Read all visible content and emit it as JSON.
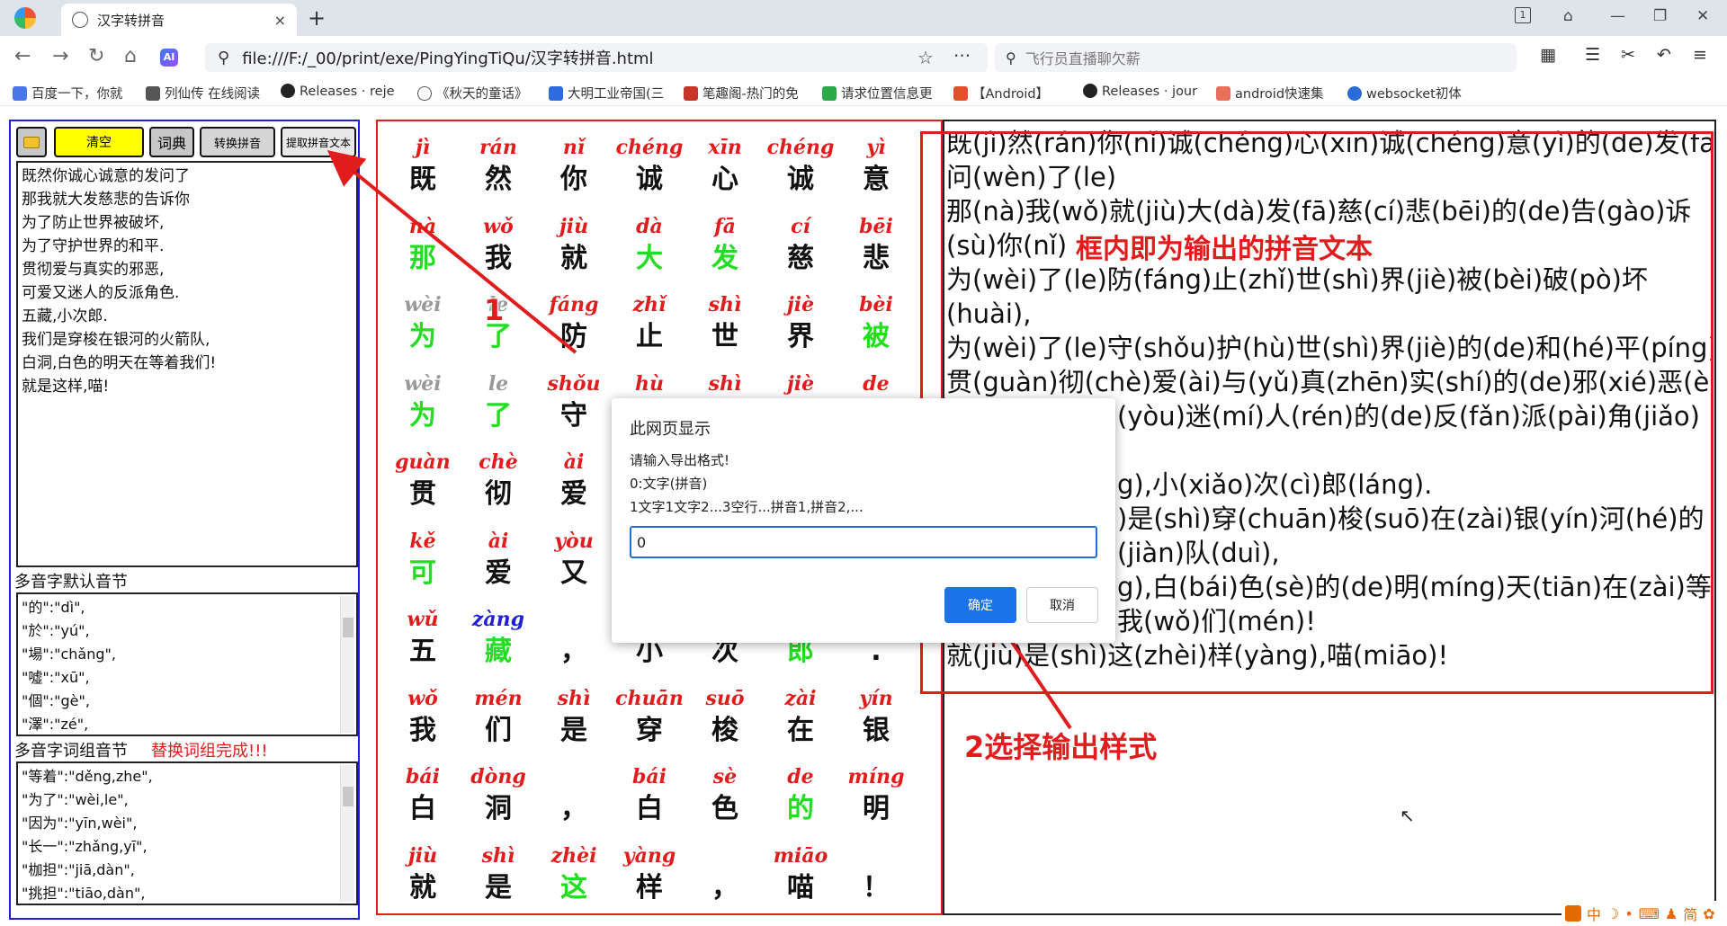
{
  "browser": {
    "tab_title": "汉字转拼音",
    "tab_close": "×",
    "new_tab": "+",
    "tab_count": "1",
    "url": "file:///F:/_00/print/exe/PingYingTiQu/汉字转拼音.html",
    "search_placeholder": "飞行员直播聊欠薪",
    "bookmarks": [
      "百度一下，你就",
      "列仙传 在线阅读",
      "Releases · reje",
      "《秋天的童话》",
      "大明工业帝国(三",
      "笔趣阁-热门的免",
      "请求位置信息更",
      "【Android】",
      "Releases · jour",
      "android快速集",
      "websocket初体"
    ],
    "colors": {
      "accent": "#e01c1c",
      "blue_border": "#1e20d8",
      "green": "#22dd22",
      "yellow": "#ffff00"
    }
  },
  "toolbar": {
    "folder_icon": "folder-icon",
    "clear": "清空",
    "dict": "词典",
    "convert": "转换拼音",
    "extract": "提取拼音文本"
  },
  "input_text": [
    "既然你诚心诚意的发问了",
    "那我就大发慈悲的告诉你",
    "为了防止世界被破坏,",
    "为了守护世界的和平.",
    "贯彻爱与真实的邪恶,",
    "可爱又迷人的反派角色.",
    "五藏,小次郎.",
    "我们是穿梭在银河的火箭队,",
    "白洞,白色的明天在等着我们!",
    "就是这样,喵!"
  ],
  "poly_default": {
    "label": "多音字默认音节",
    "items": [
      "\"的\":\"dì\",",
      "\"於\":\"yú\",",
      "\"場\":\"chǎng\",",
      "\"噓\":\"xū\",",
      "\"個\":\"gè\",",
      "\"澤\":\"zé\","
    ]
  },
  "poly_group": {
    "label": "多音字词组音节",
    "status": "替换词组完成!!!",
    "items": [
      "\"等着\":\"děng,zhe\",",
      "\"为了\":\"wèi,le\",",
      "\"因为\":\"yīn,wèi\",",
      "\"长一\":\"zhǎng,yī\",",
      "\"枷担\":\"jiā,dàn\",",
      "\"挑担\":\"tiāo,dàn\","
    ]
  },
  "grid": [
    [
      {
        "py": "jì",
        "hz": "既"
      },
      {
        "py": "rán",
        "hz": "然"
      },
      {
        "py": "nǐ",
        "hz": "你"
      },
      {
        "py": "chéng",
        "hz": "诚"
      },
      {
        "py": "xīn",
        "hz": "心"
      },
      {
        "py": "chéng",
        "hz": "诚"
      },
      {
        "py": "yì",
        "hz": "意"
      }
    ],
    [
      {
        "py": "nà",
        "hz": "那",
        "g": 1
      },
      {
        "py": "wǒ",
        "hz": "我"
      },
      {
        "py": "jiù",
        "hz": "就"
      },
      {
        "py": "dà",
        "hz": "大",
        "g": 1
      },
      {
        "py": "fā",
        "hz": "发",
        "g": 1
      },
      {
        "py": "cí",
        "hz": "慈"
      },
      {
        "py": "bēi",
        "hz": "悲"
      }
    ],
    [
      {
        "py": "wèi",
        "hz": "为",
        "g": 1,
        "gp": 1
      },
      {
        "py": "le",
        "hz": "了",
        "g": 1,
        "gp": 1
      },
      {
        "py": "fáng",
        "hz": "防"
      },
      {
        "py": "zhǐ",
        "hz": "止"
      },
      {
        "py": "shì",
        "hz": "世"
      },
      {
        "py": "jiè",
        "hz": "界"
      },
      {
        "py": "bèi",
        "hz": "被",
        "g": 1
      }
    ],
    [
      {
        "py": "wèi",
        "hz": "为",
        "g": 1,
        "gp": 1
      },
      {
        "py": "le",
        "hz": "了",
        "g": 1,
        "gp": 1
      },
      {
        "py": "shǒu",
        "hz": "守"
      },
      {
        "py": "hù",
        "hz": "护"
      },
      {
        "py": "shì",
        "hz": "世"
      },
      {
        "py": "jiè",
        "hz": "界"
      },
      {
        "py": "de",
        "hz": "的"
      }
    ],
    [
      {
        "py": "guàn",
        "hz": "贯"
      },
      {
        "py": "chè",
        "hz": "彻"
      },
      {
        "py": "ài",
        "hz": "爱"
      },
      {
        "py": "",
        "hz": ""
      },
      {
        "py": "",
        "hz": ""
      },
      {
        "py": "",
        "hz": ""
      },
      {
        "py": "",
        "hz": ""
      }
    ],
    [
      {
        "py": "kě",
        "hz": "可",
        "g": 1
      },
      {
        "py": "ài",
        "hz": "爱"
      },
      {
        "py": "yòu",
        "hz": "又"
      },
      {
        "py": "",
        "hz": ""
      },
      {
        "py": "",
        "hz": ""
      },
      {
        "py": "",
        "hz": ""
      },
      {
        "py": "",
        "hz": ""
      }
    ],
    [
      {
        "py": "wǔ",
        "hz": "五"
      },
      {
        "py": "zàng",
        "hz": "藏",
        "g": 1,
        "bp": 1
      },
      {
        "py": "",
        "hz": "，"
      },
      {
        "py": "",
        "hz": "小"
      },
      {
        "py": "",
        "hz": "次"
      },
      {
        "py": "",
        "hz": "郎",
        "g": 1
      },
      {
        "py": "",
        "hz": "."
      }
    ],
    [
      {
        "py": "wǒ",
        "hz": "我"
      },
      {
        "py": "mén",
        "hz": "们"
      },
      {
        "py": "shì",
        "hz": "是"
      },
      {
        "py": "chuān",
        "hz": "穿"
      },
      {
        "py": "suō",
        "hz": "梭"
      },
      {
        "py": "zài",
        "hz": "在"
      },
      {
        "py": "yín",
        "hz": "银"
      }
    ],
    [
      {
        "py": "bái",
        "hz": "白"
      },
      {
        "py": "dòng",
        "hz": "洞"
      },
      {
        "py": "",
        "hz": "，"
      },
      {
        "py": "bái",
        "hz": "白"
      },
      {
        "py": "sè",
        "hz": "色"
      },
      {
        "py": "de",
        "hz": "的",
        "g": 1
      },
      {
        "py": "míng",
        "hz": "明"
      }
    ],
    [
      {
        "py": "jiù",
        "hz": "就"
      },
      {
        "py": "shì",
        "hz": "是"
      },
      {
        "py": "zhèi",
        "hz": "这",
        "g": 1
      },
      {
        "py": "yàng",
        "hz": "样"
      },
      {
        "py": "",
        "hz": "，"
      },
      {
        "py": "miāo",
        "hz": "喵"
      },
      {
        "py": "",
        "hz": "！"
      }
    ]
  ],
  "output_lines": [
    "既(jì)然(rán)你(nǐ)诚(chéng)心(xīn)诚(chéng)意(yì)的(de)发(fā)",
    "问(wèn)了(le)",
    "那(nà)我(wǒ)就(jiù)大(dà)发(fā)慈(cí)悲(bēi)的(de)告(gào)诉",
    "(sù)你(nǐ)",
    "为(wèi)了(le)防(fáng)止(zhǐ)世(shì)界(jiè)被(bèi)破(pò)坏",
    "(huài),",
    "为(wèi)了(le)守(shǒu)护(hù)世(shì)界(jiè)的(de)和(hé)平(píng).",
    "贯(guàn)彻(chè)爱(ài)与(yǔ)真(zhēn)实(shí)的(de)邪(xié)恶(è),",
    "(yòu)迷(mí)人(rén)的(de)反(fǎn)派(pài)角(jiǎo)",
    "",
    "g),小(xiǎo)次(cì)郎(láng).",
    ")是(shì)穿(chuān)梭(suō)在(zài)银(yín)河(hé)的",
    "(jiàn)队(duì),",
    "g),白(bái)色(sè)的(de)明(míng)天(tiān)在(zài)等",
    "我(wǒ)们(mén)!",
    "就(jiù)是(shì)这(zhèi)样(yàng),喵(miāo)!"
  ],
  "annotations": {
    "step1": "1",
    "output_note": "框内即为输出的拼音文本",
    "step2": "2选择输出样式"
  },
  "dialog": {
    "title": "此网页显示",
    "prompt": "请输入导出格式!",
    "option0": "0:文字(拼音)",
    "option1": "1文字1文字2...3空行...拼音1,拼音2,...",
    "value": "0",
    "ok": "确定",
    "cancel": "取消"
  },
  "tray": [
    "中",
    "简"
  ]
}
